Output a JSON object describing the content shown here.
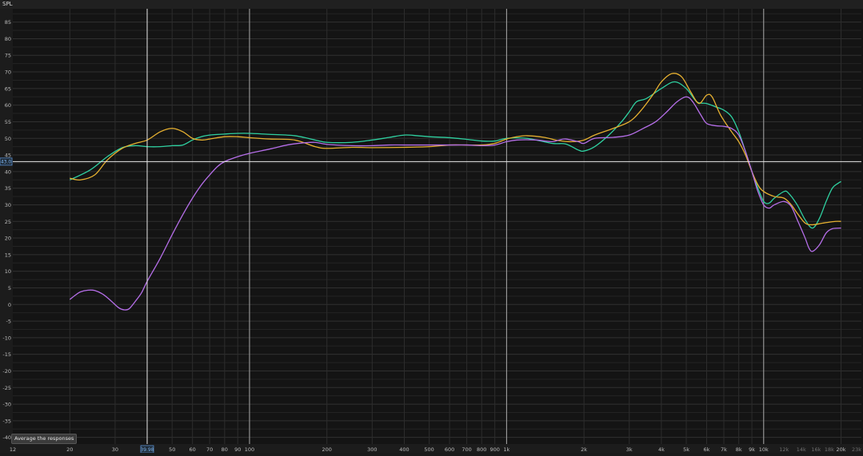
{
  "chart_data": {
    "type": "line",
    "title": "",
    "ylabel": "SPL",
    "xlabel": "",
    "x_scale": "log",
    "xlim": [
      12,
      24000
    ],
    "ylim": [
      -42,
      89
    ],
    "grid": true,
    "y_ticks": [
      85,
      80,
      75,
      70,
      65,
      60,
      55,
      50,
      45,
      40,
      35,
      30,
      25,
      20,
      15,
      10,
      5,
      0,
      -5,
      -10,
      -15,
      -20,
      -25,
      -30,
      -35,
      -40
    ],
    "x_ticks": [
      {
        "v": 12,
        "label": "12",
        "dim": false
      },
      {
        "v": 20,
        "label": "20",
        "dim": false
      },
      {
        "v": 30,
        "label": "30",
        "dim": false
      },
      {
        "v": 50,
        "label": "50",
        "dim": false
      },
      {
        "v": 60,
        "label": "60",
        "dim": false
      },
      {
        "v": 70,
        "label": "70",
        "dim": false
      },
      {
        "v": 80,
        "label": "80",
        "dim": false
      },
      {
        "v": 90,
        "label": "90",
        "dim": false
      },
      {
        "v": 100,
        "label": "100",
        "dim": false
      },
      {
        "v": 200,
        "label": "200",
        "dim": false
      },
      {
        "v": 300,
        "label": "300",
        "dim": false
      },
      {
        "v": 400,
        "label": "400",
        "dim": false
      },
      {
        "v": 500,
        "label": "500",
        "dim": false
      },
      {
        "v": 600,
        "label": "600",
        "dim": false
      },
      {
        "v": 700,
        "label": "700",
        "dim": false
      },
      {
        "v": 800,
        "label": "800",
        "dim": false
      },
      {
        "v": 900,
        "label": "900",
        "dim": false
      },
      {
        "v": 1000,
        "label": "1k",
        "dim": false
      },
      {
        "v": 2000,
        "label": "2k",
        "dim": false
      },
      {
        "v": 3000,
        "label": "3k",
        "dim": false
      },
      {
        "v": 4000,
        "label": "4k",
        "dim": false
      },
      {
        "v": 5000,
        "label": "5k",
        "dim": false
      },
      {
        "v": 6000,
        "label": "6k",
        "dim": false
      },
      {
        "v": 7000,
        "label": "7k",
        "dim": false
      },
      {
        "v": 8000,
        "label": "8k",
        "dim": false
      },
      {
        "v": 9000,
        "label": "9k",
        "dim": false
      },
      {
        "v": 10000,
        "label": "10k",
        "dim": false
      },
      {
        "v": 12000,
        "label": "12k",
        "dim": true
      },
      {
        "v": 14000,
        "label": "14k",
        "dim": true
      },
      {
        "v": 16000,
        "label": "16k",
        "dim": true
      },
      {
        "v": 18000,
        "label": "18k",
        "dim": true
      },
      {
        "v": 20000,
        "label": "20k",
        "dim": false
      },
      {
        "v": 23000,
        "label": "23k",
        "dim": true
      }
    ],
    "major_lines": [
      10,
      100,
      1000,
      10000
    ],
    "cursor": {
      "x": 39.98,
      "x_label": "39.98",
      "y": 43.0,
      "y_label": "43.0"
    },
    "series": [
      {
        "color": "#2fd0a0",
        "points": [
          [
            20,
            37.5
          ],
          [
            24,
            40.5
          ],
          [
            28,
            44.5
          ],
          [
            32,
            47.2
          ],
          [
            36,
            47.8
          ],
          [
            40,
            47.5
          ],
          [
            45,
            47.5
          ],
          [
            50,
            47.8
          ],
          [
            55,
            48
          ],
          [
            60,
            49.5
          ],
          [
            65,
            50.5
          ],
          [
            70,
            51
          ],
          [
            80,
            51.3
          ],
          [
            90,
            51.5
          ],
          [
            100,
            51.5
          ],
          [
            120,
            51.2
          ],
          [
            150,
            50.8
          ],
          [
            180,
            49.5
          ],
          [
            200,
            48.8
          ],
          [
            250,
            48.8
          ],
          [
            300,
            49.5
          ],
          [
            350,
            50.3
          ],
          [
            400,
            51
          ],
          [
            450,
            50.8
          ],
          [
            500,
            50.5
          ],
          [
            600,
            50.2
          ],
          [
            700,
            49.7
          ],
          [
            800,
            49.2
          ],
          [
            900,
            49.2
          ],
          [
            1000,
            50
          ],
          [
            1200,
            50
          ],
          [
            1500,
            48.5
          ],
          [
            1700,
            48.3
          ],
          [
            1900,
            46.5
          ],
          [
            2000,
            46.2
          ],
          [
            2200,
            47.5
          ],
          [
            2500,
            51
          ],
          [
            2800,
            55
          ],
          [
            3000,
            58
          ],
          [
            3200,
            61
          ],
          [
            3500,
            62
          ],
          [
            4000,
            65
          ],
          [
            4500,
            67
          ],
          [
            5000,
            65
          ],
          [
            5500,
            61
          ],
          [
            6000,
            60.5
          ],
          [
            6500,
            59.5
          ],
          [
            7000,
            58.5
          ],
          [
            7500,
            56.5
          ],
          [
            8000,
            52
          ],
          [
            8500,
            46
          ],
          [
            9000,
            40
          ],
          [
            9500,
            35
          ],
          [
            10000,
            31
          ],
          [
            10500,
            30.5
          ],
          [
            11000,
            32
          ],
          [
            12000,
            34
          ],
          [
            12500,
            33.5
          ],
          [
            13500,
            30
          ],
          [
            14500,
            25.5
          ],
          [
            15500,
            23
          ],
          [
            16500,
            26
          ],
          [
            17500,
            31
          ],
          [
            18500,
            35
          ],
          [
            19500,
            36.5
          ],
          [
            20000,
            37
          ]
        ]
      },
      {
        "color": "#e6b030",
        "points": [
          [
            20,
            38
          ],
          [
            22,
            37.5
          ],
          [
            25,
            39
          ],
          [
            28,
            43.5
          ],
          [
            32,
            47
          ],
          [
            36,
            48.5
          ],
          [
            40,
            49.5
          ],
          [
            45,
            52
          ],
          [
            50,
            53
          ],
          [
            55,
            52
          ],
          [
            60,
            50
          ],
          [
            65,
            49.5
          ],
          [
            70,
            49.8
          ],
          [
            80,
            50.5
          ],
          [
            90,
            50.5
          ],
          [
            100,
            50.2
          ],
          [
            120,
            49.8
          ],
          [
            150,
            49.5
          ],
          [
            180,
            47.5
          ],
          [
            200,
            47
          ],
          [
            250,
            47.3
          ],
          [
            300,
            47.2
          ],
          [
            400,
            47.3
          ],
          [
            500,
            47.5
          ],
          [
            600,
            48
          ],
          [
            700,
            48
          ],
          [
            800,
            48
          ],
          [
            900,
            48.5
          ],
          [
            1000,
            49.8
          ],
          [
            1100,
            50.5
          ],
          [
            1200,
            50.8
          ],
          [
            1400,
            50.3
          ],
          [
            1600,
            49.3
          ],
          [
            1800,
            49
          ],
          [
            2000,
            49.5
          ],
          [
            2200,
            51
          ],
          [
            2600,
            53
          ],
          [
            3000,
            55
          ],
          [
            3300,
            58
          ],
          [
            3700,
            63
          ],
          [
            4000,
            67
          ],
          [
            4400,
            69.5
          ],
          [
            4800,
            68.5
          ],
          [
            5200,
            64
          ],
          [
            5600,
            60.5
          ],
          [
            6000,
            63
          ],
          [
            6300,
            62.5
          ],
          [
            6800,
            57
          ],
          [
            7500,
            52
          ],
          [
            8000,
            49
          ],
          [
            8500,
            45
          ],
          [
            9000,
            40
          ],
          [
            9500,
            36
          ],
          [
            10000,
            34
          ],
          [
            11000,
            32.5
          ],
          [
            12000,
            32
          ],
          [
            12800,
            30
          ],
          [
            13500,
            27.5
          ],
          [
            14500,
            24.5
          ],
          [
            15500,
            24
          ],
          [
            17000,
            24.5
          ],
          [
            19000,
            25
          ],
          [
            20000,
            25
          ]
        ]
      },
      {
        "color": "#b56ee8",
        "points": [
          [
            20,
            1.5
          ],
          [
            21,
            2.8
          ],
          [
            22,
            3.8
          ],
          [
            23.5,
            4.3
          ],
          [
            25,
            4.2
          ],
          [
            27,
            3
          ],
          [
            29,
            1
          ],
          [
            31,
            -1
          ],
          [
            32.5,
            -1.6
          ],
          [
            34,
            -1.3
          ],
          [
            36,
            1
          ],
          [
            38,
            3.5
          ],
          [
            40,
            7
          ],
          [
            45,
            14
          ],
          [
            50,
            21
          ],
          [
            55,
            27
          ],
          [
            60,
            32
          ],
          [
            65,
            36
          ],
          [
            70,
            39
          ],
          [
            75,
            41.5
          ],
          [
            80,
            43
          ],
          [
            90,
            44.5
          ],
          [
            100,
            45.5
          ],
          [
            120,
            46.8
          ],
          [
            140,
            48
          ],
          [
            160,
            48.6
          ],
          [
            180,
            48.8
          ],
          [
            200,
            48.2
          ],
          [
            250,
            47.8
          ],
          [
            300,
            47.8
          ],
          [
            350,
            48
          ],
          [
            400,
            48
          ],
          [
            500,
            48
          ],
          [
            600,
            48
          ],
          [
            700,
            48
          ],
          [
            800,
            47.8
          ],
          [
            900,
            48
          ],
          [
            1000,
            49
          ],
          [
            1100,
            49.5
          ],
          [
            1300,
            49.5
          ],
          [
            1500,
            49
          ],
          [
            1600,
            49.5
          ],
          [
            1700,
            49.8
          ],
          [
            1900,
            49
          ],
          [
            2000,
            48.5
          ],
          [
            2200,
            50
          ],
          [
            2600,
            50.3
          ],
          [
            3000,
            51
          ],
          [
            3400,
            53
          ],
          [
            3800,
            55
          ],
          [
            4200,
            58
          ],
          [
            4600,
            61
          ],
          [
            5000,
            62.5
          ],
          [
            5300,
            61
          ],
          [
            5700,
            57
          ],
          [
            6000,
            54.5
          ],
          [
            6500,
            53.8
          ],
          [
            7000,
            53.6
          ],
          [
            7500,
            53
          ],
          [
            8000,
            51
          ],
          [
            8500,
            46
          ],
          [
            9000,
            40
          ],
          [
            9500,
            34
          ],
          [
            10000,
            30
          ],
          [
            10500,
            29
          ],
          [
            11000,
            30
          ],
          [
            12000,
            31
          ],
          [
            12800,
            29.5
          ],
          [
            13600,
            25
          ],
          [
            14500,
            20
          ],
          [
            15000,
            17
          ],
          [
            15500,
            16
          ],
          [
            16500,
            18
          ],
          [
            17500,
            21.5
          ],
          [
            18500,
            22.8
          ],
          [
            20000,
            23
          ]
        ]
      }
    ]
  },
  "header": {
    "label": "SPL"
  },
  "controls": {
    "average_label": "Average the responses"
  }
}
